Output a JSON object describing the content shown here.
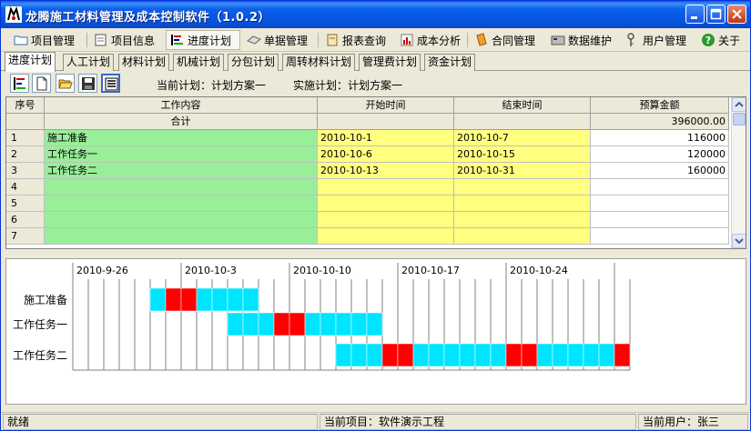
{
  "window": {
    "title": "龙腾施工材料管理及成本控制软件（1.0.2）"
  },
  "menu": [
    {
      "label": "项目管理",
      "icon": "folder-icon"
    },
    {
      "label": "项目信息",
      "icon": "document-icon"
    },
    {
      "label": "进度计划",
      "icon": "gantt-icon",
      "active": true
    },
    {
      "label": "单据管理",
      "icon": "eraser-icon"
    },
    {
      "label": "报表查询",
      "icon": "report-icon"
    },
    {
      "label": "成本分析",
      "icon": "chart-icon"
    },
    {
      "label": "合同管理",
      "icon": "contract-icon"
    },
    {
      "label": "数据维护",
      "icon": "database-icon"
    },
    {
      "label": "用户管理",
      "icon": "key-icon"
    },
    {
      "label": "关于",
      "icon": "help-icon"
    }
  ],
  "subtabs": [
    "进度计划",
    "人工计划",
    "材料计划",
    "机械计划",
    "分包计划",
    "周转材料计划",
    "管理费计划",
    "资金计划"
  ],
  "toolbar": {
    "current_plan": "当前计划：计划方案一",
    "implement_plan": "实施计划：计划方案一"
  },
  "grid": {
    "headers": [
      "序号",
      "工作内容",
      "开始时间",
      "结束时间",
      "预算金额"
    ],
    "total_label": "合计",
    "total_value": "396000.00",
    "rows": [
      {
        "no": "1",
        "task": "施工准备",
        "start": "2010-10-1",
        "end": "2010-10-7",
        "amount": "116000"
      },
      {
        "no": "2",
        "task": "工作任务一",
        "start": "2010-10-6",
        "end": "2010-10-15",
        "amount": "120000"
      },
      {
        "no": "3",
        "task": "工作任务二",
        "start": "2010-10-13",
        "end": "2010-10-31",
        "amount": "160000"
      },
      {
        "no": "4",
        "task": "",
        "start": "",
        "end": "",
        "amount": ""
      },
      {
        "no": "5",
        "task": "",
        "start": "",
        "end": "",
        "amount": ""
      },
      {
        "no": "6",
        "task": "",
        "start": "",
        "end": "",
        "amount": ""
      },
      {
        "no": "7",
        "task": "",
        "start": "",
        "end": "",
        "amount": ""
      }
    ]
  },
  "gantt": {
    "week_labels": [
      "2010-9-26",
      "2010-10-3",
      "2010-10-10",
      "2010-10-17",
      "2010-10-24"
    ],
    "first_day": "2010-9-26",
    "day_count": 36,
    "tasks": [
      {
        "name": "施工准备",
        "start_day": "2010-10-1",
        "days": [
          "cyan",
          "red",
          "red",
          "cyan",
          "cyan",
          "cyan",
          "cyan"
        ]
      },
      {
        "name": "工作任务一",
        "start_day": "2010-10-6",
        "days": [
          "cyan",
          "cyan",
          "cyan",
          "red",
          "red",
          "cyan",
          "cyan",
          "cyan",
          "cyan",
          "cyan"
        ]
      },
      {
        "name": "工作任务二",
        "start_day": "2010-10-13",
        "days": [
          "cyan",
          "cyan",
          "cyan",
          "red",
          "red",
          "cyan",
          "cyan",
          "cyan",
          "cyan",
          "cyan",
          "cyan",
          "red",
          "red",
          "cyan",
          "cyan",
          "cyan",
          "cyan",
          "cyan",
          "red"
        ]
      }
    ],
    "colors": {
      "cyan": "#00e5ff",
      "red": "#ff0000"
    }
  },
  "status": {
    "left": "就绪",
    "project": "当前项目：软件演示工程",
    "user": "当前用户：张三"
  }
}
